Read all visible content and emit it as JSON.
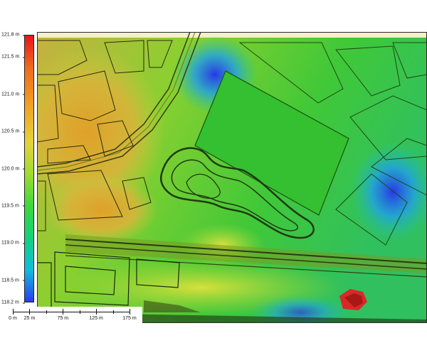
{
  "legend": {
    "ticks": [
      {
        "label": "121.8 m",
        "value": 121.8
      },
      {
        "label": "121.5 m",
        "value": 121.5
      },
      {
        "label": "121.0 m",
        "value": 121.0
      },
      {
        "label": "120.5 m",
        "value": 120.5
      },
      {
        "label": "120.0 m",
        "value": 120.0
      },
      {
        "label": "119.5 m",
        "value": 119.5
      },
      {
        "label": "119.0 m",
        "value": 119.0
      },
      {
        "label": "118.5 m",
        "value": 118.5
      },
      {
        "label": "118.2 m",
        "value": 118.2
      }
    ],
    "min": 118.2,
    "max": 121.8
  },
  "scalebar": {
    "ticks": [
      {
        "label": "0 m",
        "value": 0
      },
      {
        "label": "25 m",
        "value": 25
      },
      {
        "label": "75 m",
        "value": 75
      },
      {
        "label": "125 m",
        "value": 125
      },
      {
        "label": "175 m",
        "value": 175
      }
    ],
    "max": 175
  },
  "colors": {
    "high": "#e8141c",
    "mid_high": "#f0a022",
    "mid": "#a0dc30",
    "low_mid": "#3cd83a",
    "low": "#2a3cf0"
  }
}
